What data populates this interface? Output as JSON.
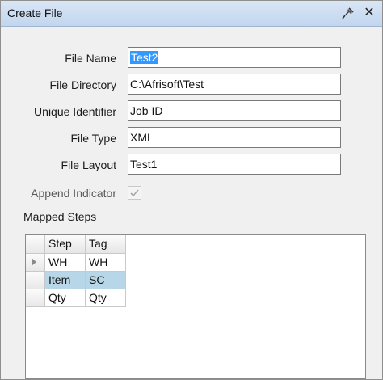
{
  "window": {
    "title": "Create File"
  },
  "form": {
    "file_name": {
      "label": "File Name",
      "value": "Test2"
    },
    "file_directory": {
      "label": "File Directory",
      "value": "C:\\Afrisoft\\Test"
    },
    "unique_identifier": {
      "label": "Unique Identifier",
      "value": "Job ID"
    },
    "file_type": {
      "label": "File Type",
      "value": "XML"
    },
    "file_layout": {
      "label": "File Layout",
      "value": "Test1"
    },
    "append_indicator": {
      "label": "Append Indicator",
      "checked": true
    }
  },
  "mapped_steps": {
    "label": "Mapped Steps",
    "columns": [
      "Step",
      "Tag"
    ],
    "rows": [
      {
        "step": "WH",
        "tag": "WH",
        "current": true
      },
      {
        "step": "Item",
        "tag": "SC",
        "selected": true
      },
      {
        "step": "Qty",
        "tag": "Qty"
      }
    ]
  },
  "icons": {
    "pin": "pin-icon",
    "close": "close-icon",
    "check": "checkmark-icon",
    "row_indicator": "row-arrow-icon"
  }
}
